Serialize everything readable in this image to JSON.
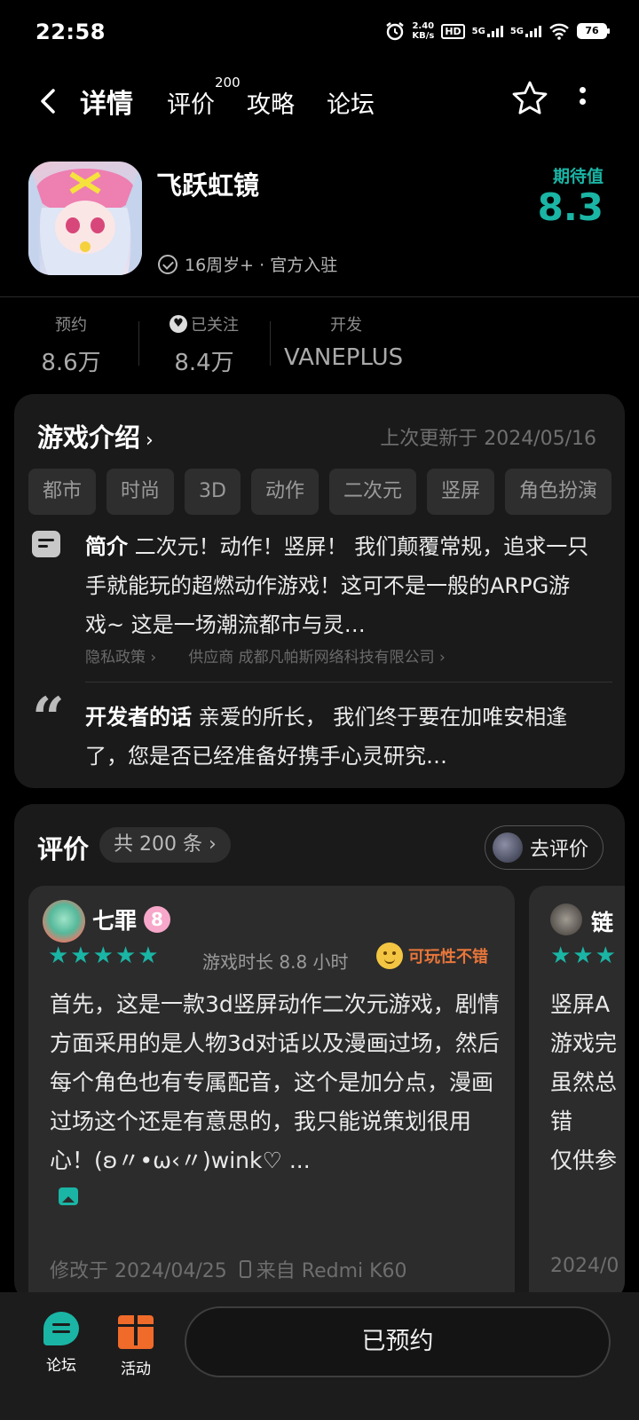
{
  "status_bar": {
    "time": "22:58",
    "net_speed_value": "2.40",
    "net_speed_unit": "KB/s",
    "hd_label": "HD",
    "signal1_label": "5G",
    "signal2_label": "5G",
    "battery": "76"
  },
  "nav": {
    "tabs": [
      {
        "label": "详情"
      },
      {
        "label": "评价"
      },
      {
        "label": "攻略"
      },
      {
        "label": "论坛"
      }
    ],
    "review_badge": "200"
  },
  "app": {
    "name": "飞跃虹镜",
    "meta": "16周岁+ · 官方入驻",
    "expect_label": "期待值",
    "expect_value": "8.3"
  },
  "stats": [
    {
      "label": "预约",
      "value": "8.6万"
    },
    {
      "label": "已关注",
      "value": "8.4万"
    },
    {
      "label": "开发",
      "value": "VANEPLUS"
    }
  ],
  "intro": {
    "title": "游戏介绍",
    "updated": "上次更新于 2024/05/16",
    "tags": [
      "都市",
      "时尚",
      "3D",
      "动作",
      "二次元",
      "竖屏",
      "角色扮演"
    ],
    "summary_label": "简介",
    "summary_text": "二次元！动作！竖屏！ 我们颠覆常规，追求一只手就能玩的超燃动作游戏！这可不是一般的ARPG游戏~ 这是一场潮流都市与灵…",
    "privacy_link": "隐私政策 ›",
    "supplier_link": "供应商 成都凡帕斯网络科技有限公司 ›",
    "dev_label": "开发者的话",
    "dev_text": "亲爱的所长， 我们终于要在加唯安相逢了，您是否已经准备好携手心灵研究…"
  },
  "reviews": {
    "title": "评价",
    "count_label": "共 200 条 ›",
    "write_label": "去评价",
    "items": [
      {
        "user": "七罪",
        "level": "8",
        "stars": "★★★★★",
        "playtime": "游戏时长 8.8 小时",
        "tag": "可玩性不错",
        "text": "首先，这是一款3d竖屏动作二次元游戏，剧情方面采用的是人物3d对话以及漫画过场，然后每个角色也有专属配音，这个是加分点，漫画过场这个还是有意思的，我只能说策划很用心！(ʚ〃•ω‹〃)wink♡ ...",
        "edited": "修改于 2024/04/25",
        "device": "来自 Redmi K60"
      },
      {
        "user": "链",
        "stars": "★★★",
        "text": "竖屏A\n游戏完\n虽然总\n错\n仅供参",
        "edited": "2024/0"
      }
    ]
  },
  "bottom": {
    "forum_label": "论坛",
    "activity_label": "活动",
    "reserve_label": "已预约"
  },
  "colors": {
    "accent": "#1ab5a5",
    "tag_orange": "#e8763a",
    "background": "#000000",
    "card": "#1a1a1a"
  },
  "icons": [
    "back-arrow-icon",
    "star-outline-icon",
    "more-vertical-icon",
    "verified-check-icon",
    "heart-icon",
    "summary-icon",
    "quote-icon",
    "smile-icon",
    "image-icon",
    "phone-icon",
    "forum-icon",
    "gift-icon"
  ]
}
